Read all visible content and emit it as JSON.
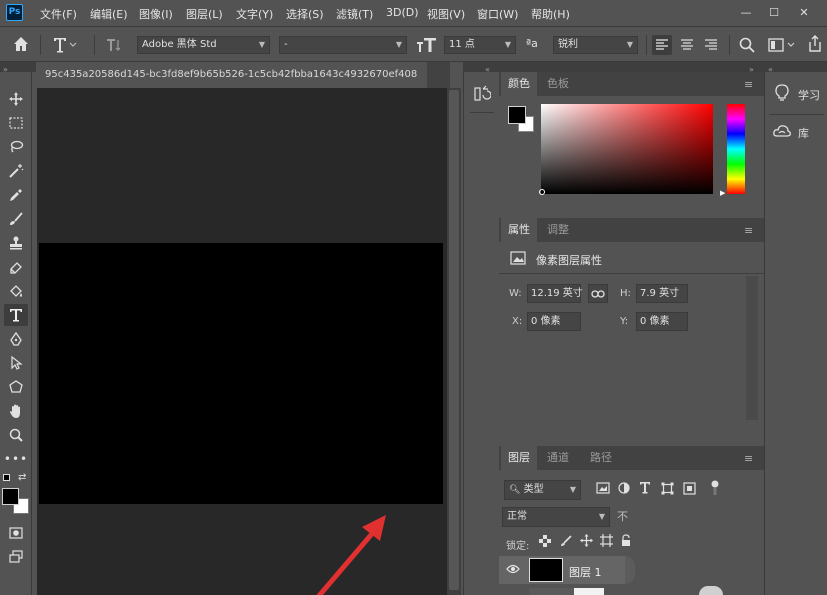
{
  "app": {
    "logo": "Ps"
  },
  "menu": [
    "文件(F)",
    "编辑(E)",
    "图像(I)",
    "图层(L)",
    "文字(Y)",
    "选择(S)",
    "滤镜(T)",
    "3D(D)",
    "视图(V)",
    "窗口(W)",
    "帮助(H)"
  ],
  "window_controls": {
    "minimize": "—",
    "maximize": "☐",
    "close": "✕"
  },
  "options": {
    "font_family": "Adobe 黑体 Std",
    "font_style": "-",
    "font_size": "11 点",
    "aa_label": "ªa",
    "antialias": "锐利"
  },
  "document": {
    "tab_title": "95c435a20586d145-bc3fd8ef9b65b526-1c5cb42fbba1643c4932670ef408"
  },
  "color_panel": {
    "tabs": [
      "颜色",
      "色板"
    ],
    "foreground": "#000000",
    "background": "#ffffff"
  },
  "properties_panel": {
    "tabs": [
      "属性",
      "调整"
    ],
    "title": "像素图层属性",
    "w_label": "W:",
    "w_value": "12.19 英寸",
    "h_label": "H:",
    "h_value": "7.9 英寸",
    "x_label": "X:",
    "x_value": "0 像素",
    "y_label": "Y:",
    "y_value": "0 像素"
  },
  "layers_panel": {
    "tabs": [
      "图层",
      "通道",
      "路径"
    ],
    "filter_type": "类型",
    "blend_mode": "正常",
    "lock_label": "锁定:",
    "layers": [
      {
        "name": "图层 1"
      }
    ]
  },
  "right_panel": {
    "items": [
      {
        "label": "学习",
        "icon": "lightbulb-icon"
      },
      {
        "label": "库",
        "icon": "libraries-icon"
      }
    ]
  },
  "colors": {
    "accent_ps": "#31a8ff",
    "annotation_arrow": "#e03030"
  }
}
